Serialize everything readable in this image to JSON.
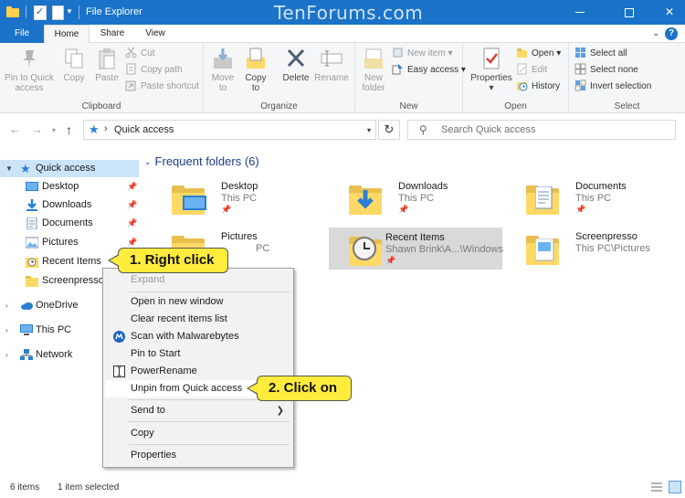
{
  "window": {
    "title": "File Explorer",
    "watermark": "TenForums.com",
    "minimize_glyph": "",
    "close_glyph": "✕"
  },
  "tabs": [
    {
      "label": "File"
    },
    {
      "label": "Home"
    },
    {
      "label": "Share"
    },
    {
      "label": "View"
    }
  ],
  "ribbon": {
    "groups": {
      "clipboard": "Clipboard",
      "organize": "Organize",
      "new": "New",
      "open": "Open",
      "select": "Select"
    },
    "pin_to_quick_access": "Pin to Quick access",
    "copy": "Copy",
    "paste": "Paste",
    "cut": "Cut",
    "copy_path": "Copy path",
    "paste_shortcut": "Paste shortcut",
    "move_to": "Move to",
    "copy_to": "Copy to",
    "delete": "Delete",
    "rename": "Rename",
    "new_folder": "New folder",
    "new_item": "New item",
    "easy_access": "Easy access",
    "properties": "Properties",
    "open": "Open",
    "edit": "Edit",
    "history": "History",
    "select_all": "Select all",
    "select_none": "Select none",
    "invert_selection": "Invert selection"
  },
  "address": {
    "path": "Quick access",
    "search_placeholder": "Search Quick access"
  },
  "nav": {
    "quick_access": "Quick access",
    "pinned": [
      {
        "label": "Desktop"
      },
      {
        "label": "Downloads"
      },
      {
        "label": "Documents"
      },
      {
        "label": "Pictures"
      },
      {
        "label": "Recent Items"
      },
      {
        "label": "Screenpresso"
      }
    ],
    "onedrive": "OneDrive",
    "this_pc": "This PC",
    "network": "Network"
  },
  "content": {
    "section_title": "Frequent folders (6)",
    "folders": [
      {
        "name": "Desktop",
        "location": "This PC"
      },
      {
        "name": "Downloads",
        "location": "This PC"
      },
      {
        "name": "Documents",
        "location": "This PC"
      },
      {
        "name": "Pictures",
        "location": "PC"
      },
      {
        "name": "Recent Items",
        "location": "Shawn Brink\\A...\\Windows"
      },
      {
        "name": "Screenpresso",
        "location": "This PC\\Pictures"
      }
    ]
  },
  "context_menu": {
    "items": {
      "expand": "Expand",
      "open_new_window": "Open in new window",
      "clear_recent": "Clear recent items list",
      "scan_malwarebytes": "Scan with Malwarebytes",
      "pin_to_start": "Pin to Start",
      "powerrename": "PowerRename",
      "unpin_quick_access": "Unpin from Quick access",
      "send_to": "Send to",
      "copy": "Copy",
      "properties": "Properties"
    }
  },
  "callouts": {
    "step1": "1. Right click",
    "step2": "2. Click on"
  },
  "status": {
    "item_count": "6 items",
    "selection": "1 item selected"
  },
  "colors": {
    "titlebar": "#1a73c8",
    "selection": "#cce4f7",
    "callout": "#ffec3d",
    "folder": "#ffd966"
  }
}
